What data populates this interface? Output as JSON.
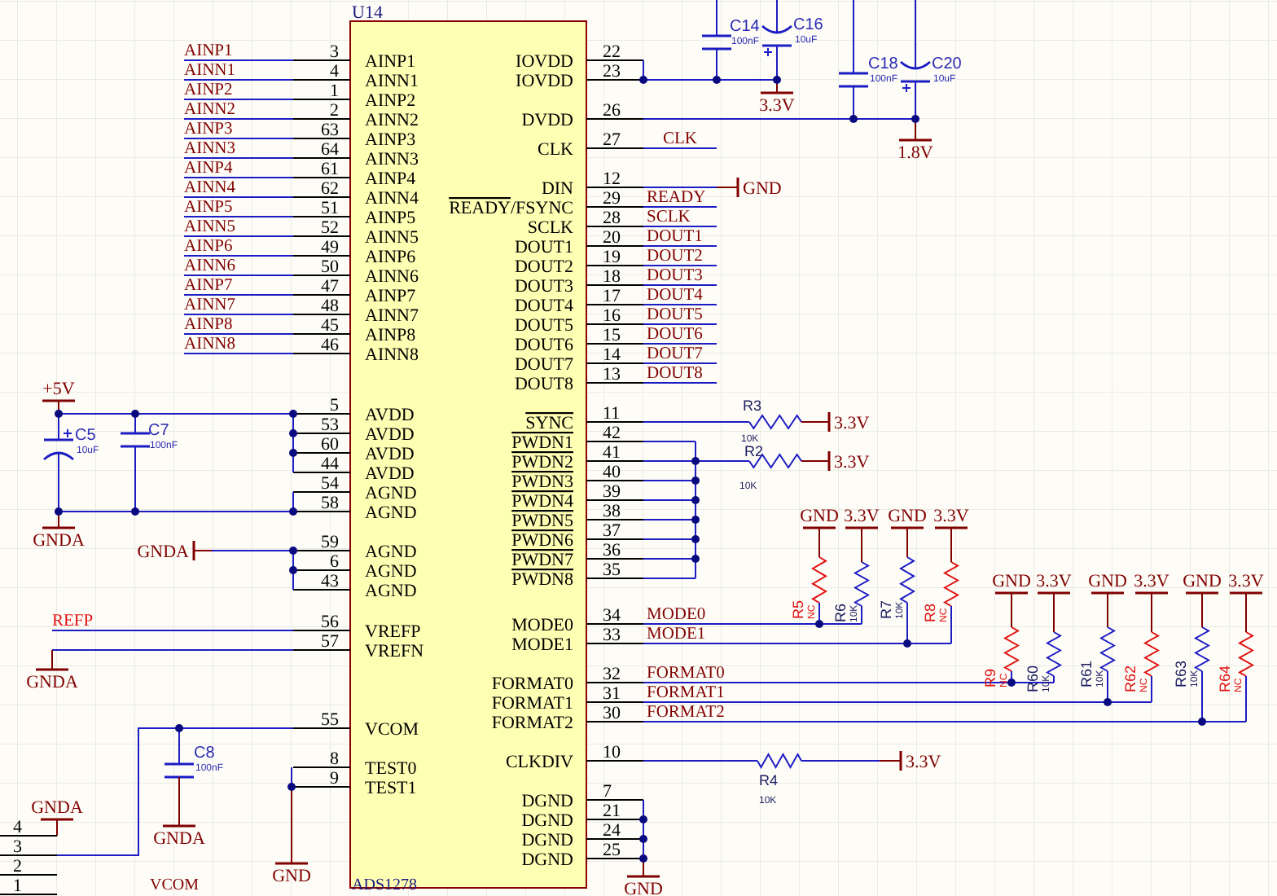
{
  "schematic": {
    "chip": {
      "designator": "U14",
      "part": "ADS1278",
      "left_pins": [
        {
          "number": "3",
          "name": "AINP1",
          "net": "AINP1"
        },
        {
          "number": "4",
          "name": "AINN1",
          "net": "AINN1"
        },
        {
          "number": "1",
          "name": "AINP2",
          "net": "AINP2"
        },
        {
          "number": "2",
          "name": "AINN2",
          "net": "AINN2"
        },
        {
          "number": "63",
          "name": "AINP3",
          "net": "AINP3"
        },
        {
          "number": "64",
          "name": "AINN3",
          "net": "AINN3"
        },
        {
          "number": "61",
          "name": "AINP4",
          "net": "AINP4"
        },
        {
          "number": "62",
          "name": "AINN4",
          "net": "AINN4"
        },
        {
          "number": "51",
          "name": "AINP5",
          "net": "AINP5"
        },
        {
          "number": "52",
          "name": "AINN5",
          "net": "AINN5"
        },
        {
          "number": "49",
          "name": "AINP6",
          "net": "AINP6"
        },
        {
          "number": "50",
          "name": "AINN6",
          "net": "AINN6"
        },
        {
          "number": "47",
          "name": "AINP7",
          "net": "AINP7"
        },
        {
          "number": "48",
          "name": "AINN7",
          "net": "AINN7"
        },
        {
          "number": "45",
          "name": "AINP8",
          "net": "AINP8"
        },
        {
          "number": "46",
          "name": "AINN8",
          "net": "AINN8"
        },
        {
          "number": "5",
          "name": "AVDD"
        },
        {
          "number": "53",
          "name": "AVDD"
        },
        {
          "number": "60",
          "name": "AVDD"
        },
        {
          "number": "44",
          "name": "AVDD"
        },
        {
          "number": "54",
          "name": "AGND"
        },
        {
          "number": "58",
          "name": "AGND"
        },
        {
          "number": "59",
          "name": "AGND"
        },
        {
          "number": "6",
          "name": "AGND"
        },
        {
          "number": "43",
          "name": "AGND"
        },
        {
          "number": "56",
          "name": "VREFP",
          "net": "REFP"
        },
        {
          "number": "57",
          "name": "VREFN"
        },
        {
          "number": "55",
          "name": "VCOM"
        },
        {
          "number": "8",
          "name": "TEST0"
        },
        {
          "number": "9",
          "name": "TEST1"
        }
      ],
      "right_pins": [
        {
          "number": "22",
          "name": "IOVDD",
          "active_low": false
        },
        {
          "number": "23",
          "name": "IOVDD",
          "active_low": false
        },
        {
          "number": "26",
          "name": "DVDD",
          "active_low": false
        },
        {
          "number": "27",
          "name": "CLK",
          "active_low": false,
          "net": "CLK"
        },
        {
          "number": "12",
          "name": "DIN",
          "active_low": false
        },
        {
          "number": "29",
          "name": "READY/FSYNC",
          "active_low": true,
          "net": "READY"
        },
        {
          "number": "28",
          "name": "SCLK",
          "active_low": false,
          "net": "SCLK"
        },
        {
          "number": "20",
          "name": "DOUT1",
          "active_low": false,
          "net": "DOUT1"
        },
        {
          "number": "19",
          "name": "DOUT2",
          "active_low": false,
          "net": "DOUT2"
        },
        {
          "number": "18",
          "name": "DOUT3",
          "active_low": false,
          "net": "DOUT3"
        },
        {
          "number": "17",
          "name": "DOUT4",
          "active_low": false,
          "net": "DOUT4"
        },
        {
          "number": "16",
          "name": "DOUT5",
          "active_low": false,
          "net": "DOUT5"
        },
        {
          "number": "15",
          "name": "DOUT6",
          "active_low": false,
          "net": "DOUT6"
        },
        {
          "number": "14",
          "name": "DOUT7",
          "active_low": false,
          "net": "DOUT7"
        },
        {
          "number": "13",
          "name": "DOUT8",
          "active_low": false,
          "net": "DOUT8"
        },
        {
          "number": "11",
          "name": "SYNC",
          "active_low": true
        },
        {
          "number": "42",
          "name": "PWDN1",
          "active_low": true
        },
        {
          "number": "41",
          "name": "PWDN2",
          "active_low": true
        },
        {
          "number": "40",
          "name": "PWDN3",
          "active_low": true
        },
        {
          "number": "39",
          "name": "PWDN4",
          "active_low": true
        },
        {
          "number": "38",
          "name": "PWDN5",
          "active_low": true
        },
        {
          "number": "37",
          "name": "PWDN6",
          "active_low": true
        },
        {
          "number": "36",
          "name": "PWDN7",
          "active_low": true
        },
        {
          "number": "35",
          "name": "PWDN8",
          "active_low": true
        },
        {
          "number": "34",
          "name": "MODE0",
          "active_low": false,
          "net": "MODE0"
        },
        {
          "number": "33",
          "name": "MODE1",
          "active_low": false,
          "net": "MODE1"
        },
        {
          "number": "32",
          "name": "FORMAT0",
          "active_low": false,
          "net": "FORMAT0"
        },
        {
          "number": "31",
          "name": "FORMAT1",
          "active_low": false,
          "net": "FORMAT1"
        },
        {
          "number": "30",
          "name": "FORMAT2",
          "active_low": false,
          "net": "FORMAT2"
        },
        {
          "number": "10",
          "name": "CLKDIV",
          "active_low": false
        },
        {
          "number": "7",
          "name": "DGND",
          "active_low": false
        },
        {
          "number": "21",
          "name": "DGND",
          "active_low": false
        },
        {
          "number": "24",
          "name": "DGND",
          "active_low": false
        },
        {
          "number": "25",
          "name": "DGND",
          "active_low": false
        }
      ]
    },
    "capacitors": [
      {
        "designator": "C14",
        "value": "100nF",
        "kind": "ceramic"
      },
      {
        "designator": "C16",
        "value": "10uF",
        "kind": "polarized"
      },
      {
        "designator": "C18",
        "value": "100nF",
        "kind": "ceramic"
      },
      {
        "designator": "C20",
        "value": "10uF",
        "kind": "polarized"
      },
      {
        "designator": "C5",
        "value": "10uF",
        "kind": "polarized"
      },
      {
        "designator": "C7",
        "value": "100nF",
        "kind": "ceramic"
      },
      {
        "designator": "C8",
        "value": "100nF",
        "kind": "ceramic"
      }
    ],
    "resistors": [
      {
        "designator": "R3",
        "value": "10K",
        "fitted": true
      },
      {
        "designator": "R2",
        "value": "10K",
        "fitted": true
      },
      {
        "designator": "R5",
        "value": "NC",
        "fitted": false
      },
      {
        "designator": "R6",
        "value": "10K",
        "fitted": true
      },
      {
        "designator": "R7",
        "value": "10K",
        "fitted": true
      },
      {
        "designator": "R8",
        "value": "NC",
        "fitted": false
      },
      {
        "designator": "R9",
        "value": "NC",
        "fitted": false
      },
      {
        "designator": "R60",
        "value": "10K",
        "fitted": true
      },
      {
        "designator": "R61",
        "value": "10K",
        "fitted": true
      },
      {
        "designator": "R62",
        "value": "NC",
        "fitted": false
      },
      {
        "designator": "R63",
        "value": "10K",
        "fitted": true
      },
      {
        "designator": "R64",
        "value": "NC",
        "fitted": false
      },
      {
        "designator": "R4",
        "value": "10K",
        "fitted": true
      }
    ],
    "power_ports": [
      {
        "label": "3.3V"
      },
      {
        "label": "1.8V"
      },
      {
        "label": "GND"
      },
      {
        "label": "+5V"
      },
      {
        "label": "GNDA"
      },
      {
        "label": "GNDA"
      },
      {
        "label": "3.3V"
      },
      {
        "label": "3.3V"
      },
      {
        "label": "GND"
      },
      {
        "label": "3.3V"
      },
      {
        "label": "GND"
      },
      {
        "label": "3.3V"
      },
      {
        "label": "GND"
      },
      {
        "label": "3.3V"
      },
      {
        "label": "GND"
      },
      {
        "label": "3.3V"
      },
      {
        "label": "GND"
      },
      {
        "label": "3.3V"
      },
      {
        "label": "GNDA"
      },
      {
        "label": "GNDA"
      },
      {
        "label": "3.3V"
      },
      {
        "label": "GNDA"
      },
      {
        "label": "GND"
      },
      {
        "label": "GND"
      }
    ],
    "connector": {
      "pins": [
        {
          "number": "4"
        },
        {
          "number": "3"
        },
        {
          "number": "2"
        },
        {
          "number": "1"
        }
      ]
    },
    "net_labels": [
      {
        "text": "VCOM"
      }
    ]
  }
}
